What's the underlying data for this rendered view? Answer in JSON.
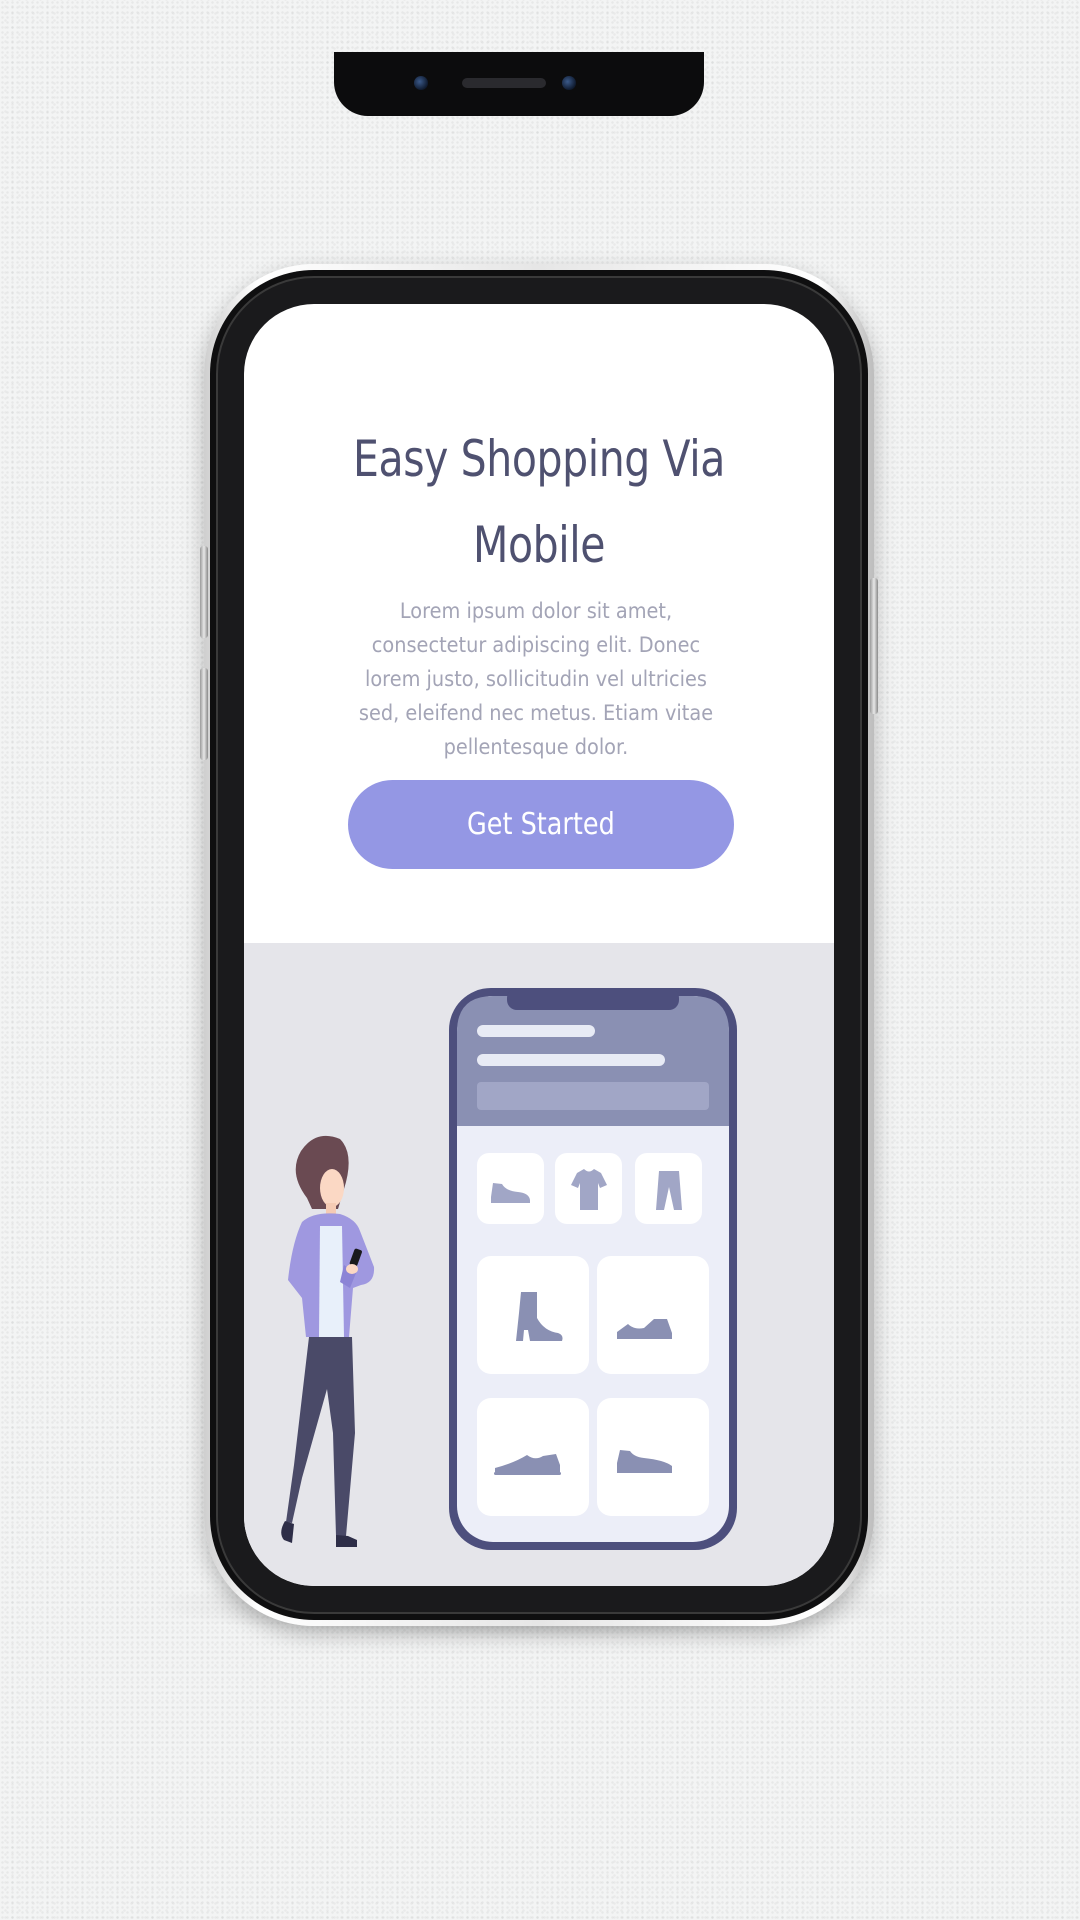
{
  "hero": {
    "title_line1": "Easy Shopping Via",
    "title_line2": "Mobile",
    "description": "Lorem ipsum dolor sit amet, consectetur adipiscing elit. Donec lorem justo, sollicitudin vel ultricies sed, eleifend nec metus. Etiam vitae pellentesque dolor.",
    "cta_label": "Get Started"
  },
  "illustration": {
    "category_icons": [
      "sneaker-icon",
      "tshirt-icon",
      "pants-icon"
    ],
    "product_icons": [
      "boot-icon",
      "sneaker-icon",
      "sneaker-icon",
      "sneaker-icon"
    ]
  },
  "colors": {
    "accent": "#9497e4",
    "title": "#4f5170",
    "body_text": "#a3a4b6",
    "illustration_bg": "#e5e5ea",
    "illustration_phone": "#4d4f7d"
  }
}
